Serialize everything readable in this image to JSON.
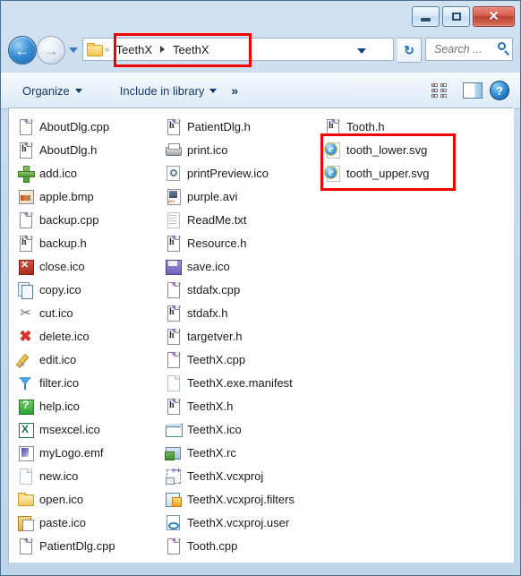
{
  "window": {
    "controls": {
      "minimize": "–",
      "maximize": "□",
      "close": "✕"
    }
  },
  "navigation": {
    "back_label": "←",
    "forward_label": "→",
    "recent_dropdown": "▾"
  },
  "address_bar": {
    "overflow_chevron": "«",
    "crumbs": [
      "TeethX",
      "TeethX"
    ],
    "separator": "▶",
    "dropdown": "▾",
    "refresh_label": "↻"
  },
  "search": {
    "placeholder": "Search ...",
    "value": "",
    "icon": "search-icon"
  },
  "toolbar": {
    "organize_label": "Organize",
    "include_label": "Include in library",
    "overflow_label": "»",
    "view_dropdown": "▾",
    "help_label": "?"
  },
  "highlight_color": "#f20000",
  "columns": [
    {
      "items": [
        {
          "name": "AboutDlg.cpp",
          "icon": "cpp-file-icon"
        },
        {
          "name": "AboutDlg.h",
          "icon": "header-file-icon"
        },
        {
          "name": "add.ico",
          "icon": "green-plus-icon"
        },
        {
          "name": "apple.bmp",
          "icon": "bitmap-image-icon"
        },
        {
          "name": "backup.cpp",
          "icon": "cpp-file-icon"
        },
        {
          "name": "backup.h",
          "icon": "header-file-icon"
        },
        {
          "name": "close.ico",
          "icon": "red-close-icon"
        },
        {
          "name": "copy.ico",
          "icon": "copy-pages-icon"
        },
        {
          "name": "cut.ico",
          "icon": "scissors-icon"
        },
        {
          "name": "delete.ico",
          "icon": "red-x-icon"
        },
        {
          "name": "edit.ico",
          "icon": "pencil-icon"
        },
        {
          "name": "filter.ico",
          "icon": "funnel-icon"
        },
        {
          "name": "help.ico",
          "icon": "green-question-icon"
        },
        {
          "name": "msexcel.ico",
          "icon": "excel-icon"
        },
        {
          "name": "myLogo.emf",
          "icon": "emf-image-icon"
        },
        {
          "name": "new.ico",
          "icon": "blank-page-icon"
        },
        {
          "name": "open.ico",
          "icon": "open-folder-icon"
        },
        {
          "name": "paste.ico",
          "icon": "clipboard-icon"
        },
        {
          "name": "PatientDlg.cpp",
          "icon": "cpp-file-icon"
        }
      ]
    },
    {
      "items": [
        {
          "name": "PatientDlg.h",
          "icon": "header-file-icon"
        },
        {
          "name": "print.ico",
          "icon": "printer-icon"
        },
        {
          "name": "printPreview.ico",
          "icon": "print-preview-icon"
        },
        {
          "name": "purple.avi",
          "icon": "avi-video-icon"
        },
        {
          "name": "ReadMe.txt",
          "icon": "text-file-icon"
        },
        {
          "name": "Resource.h",
          "icon": "header-file-icon"
        },
        {
          "name": "save.ico",
          "icon": "floppy-disk-icon"
        },
        {
          "name": "stdafx.cpp",
          "icon": "cpp-file-icon"
        },
        {
          "name": "stdafx.h",
          "icon": "header-file-icon"
        },
        {
          "name": "targetver.h",
          "icon": "header-file-icon"
        },
        {
          "name": "TeethX.cpp",
          "icon": "cpp-file-icon"
        },
        {
          "name": "TeethX.exe.manifest",
          "icon": "blank-page-icon"
        },
        {
          "name": "TeethX.h",
          "icon": "header-file-icon"
        },
        {
          "name": "TeethX.ico",
          "icon": "window-icon"
        },
        {
          "name": "TeethX.rc",
          "icon": "resource-script-icon"
        },
        {
          "name": "TeethX.vcxproj",
          "icon": "vcxproj-icon"
        },
        {
          "name": "TeethX.vcxproj.filters",
          "icon": "vcxproj-filters-icon"
        },
        {
          "name": "TeethX.vcxproj.user",
          "icon": "vcxproj-user-icon"
        },
        {
          "name": "Tooth.cpp",
          "icon": "cpp-file-icon"
        }
      ]
    },
    {
      "items": [
        {
          "name": "Tooth.h",
          "icon": "header-file-icon"
        },
        {
          "name": "tooth_lower.svg",
          "icon": "internet-explorer-icon"
        },
        {
          "name": "tooth_upper.svg",
          "icon": "internet-explorer-icon"
        }
      ]
    }
  ]
}
